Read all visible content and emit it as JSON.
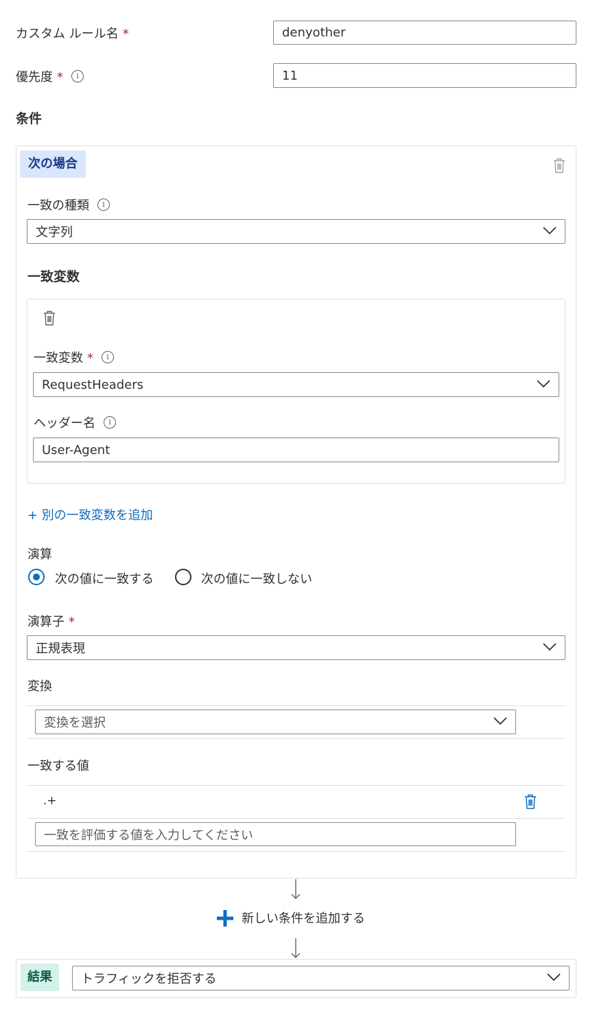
{
  "rule_name": {
    "label": "カスタム ルール名",
    "required_mark": "*",
    "value": "denyother"
  },
  "priority": {
    "label": "優先度",
    "required_mark": "*",
    "info": "i",
    "value": "11"
  },
  "conditions": {
    "title": "条件",
    "if_chip": "次の場合",
    "match_type": {
      "label": "一致の種類",
      "info": "i",
      "value": "文字列"
    },
    "match_variables": {
      "title": "一致変数",
      "variable": {
        "label": "一致変数",
        "required_mark": "*",
        "info": "i",
        "value": "RequestHeaders"
      },
      "header_name": {
        "label": "ヘッダー名",
        "info": "i",
        "value": "User-Agent"
      },
      "add_link": "+ 別の一致変数を追加"
    },
    "operation": {
      "label": "演算",
      "options": [
        {
          "label": "次の値に一致する",
          "selected": true
        },
        {
          "label": "次の値に一致しない",
          "selected": false
        }
      ]
    },
    "operator": {
      "label": "演算子",
      "required_mark": "*",
      "value": "正規表現"
    },
    "transform": {
      "label": "変換",
      "placeholder": "変換を選択"
    },
    "match_values": {
      "label": "一致する値",
      "items": [
        ".+"
      ],
      "placeholder": "一致を評価する値を入力してください"
    }
  },
  "add_condition": {
    "label": "新しい条件を追加する",
    "icon": "plus-icon"
  },
  "result": {
    "chip": "結果",
    "value": "トラフィックを拒否する"
  },
  "colors": {
    "accent": "#0f6cbd",
    "required": "#a4262c",
    "if_chip_bg": "#dae6fb",
    "result_chip_bg": "#d4f1ea"
  }
}
